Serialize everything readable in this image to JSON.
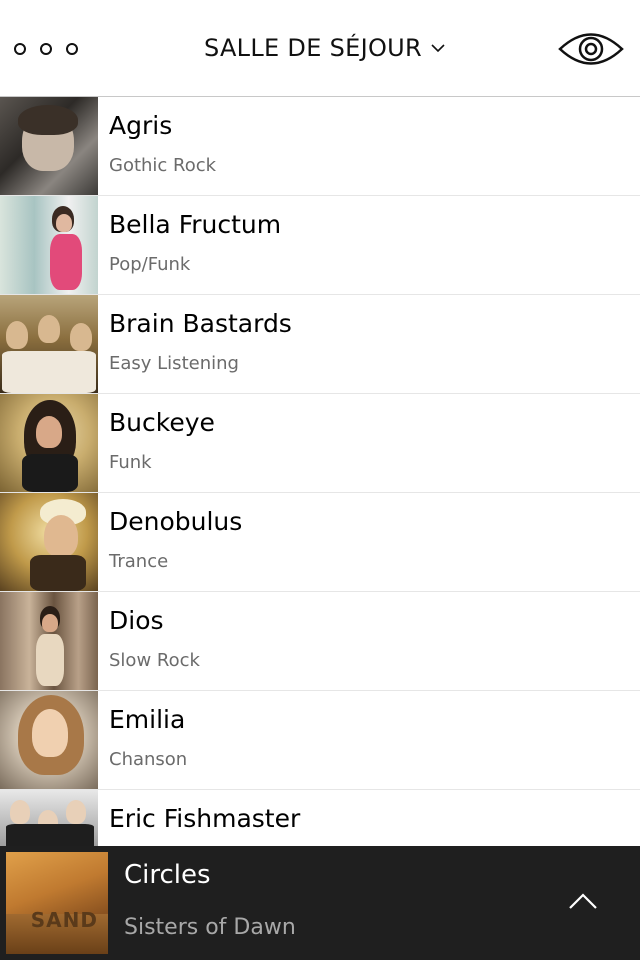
{
  "header": {
    "room_title": "SALLE DE SÉJOUR",
    "menu_icon": "more-dots-icon",
    "room_dropdown_icon": "chevron-down-icon",
    "view_icon": "eye-icon"
  },
  "artists": [
    {
      "name": "Agris",
      "genre": "Gothic Rock"
    },
    {
      "name": "Bella Fructum",
      "genre": "Pop/Funk"
    },
    {
      "name": "Brain Bastards",
      "genre": "Easy Listening"
    },
    {
      "name": "Buckeye",
      "genre": "Funk"
    },
    {
      "name": "Denobulus",
      "genre": "Trance"
    },
    {
      "name": "Dios",
      "genre": "Slow Rock"
    },
    {
      "name": "Emilia",
      "genre": "Chanson"
    },
    {
      "name": "Eric Fishmaster",
      "genre": ""
    }
  ],
  "now_playing": {
    "title": "Circles",
    "artist": "Sisters of Dawn",
    "cover_text": "SAND",
    "expand_icon": "chevron-up-icon"
  },
  "colors": {
    "now_playing_bg": "#1f1f1f",
    "genre_text": "#6b6b6b",
    "divider": "#e6e6e6"
  }
}
